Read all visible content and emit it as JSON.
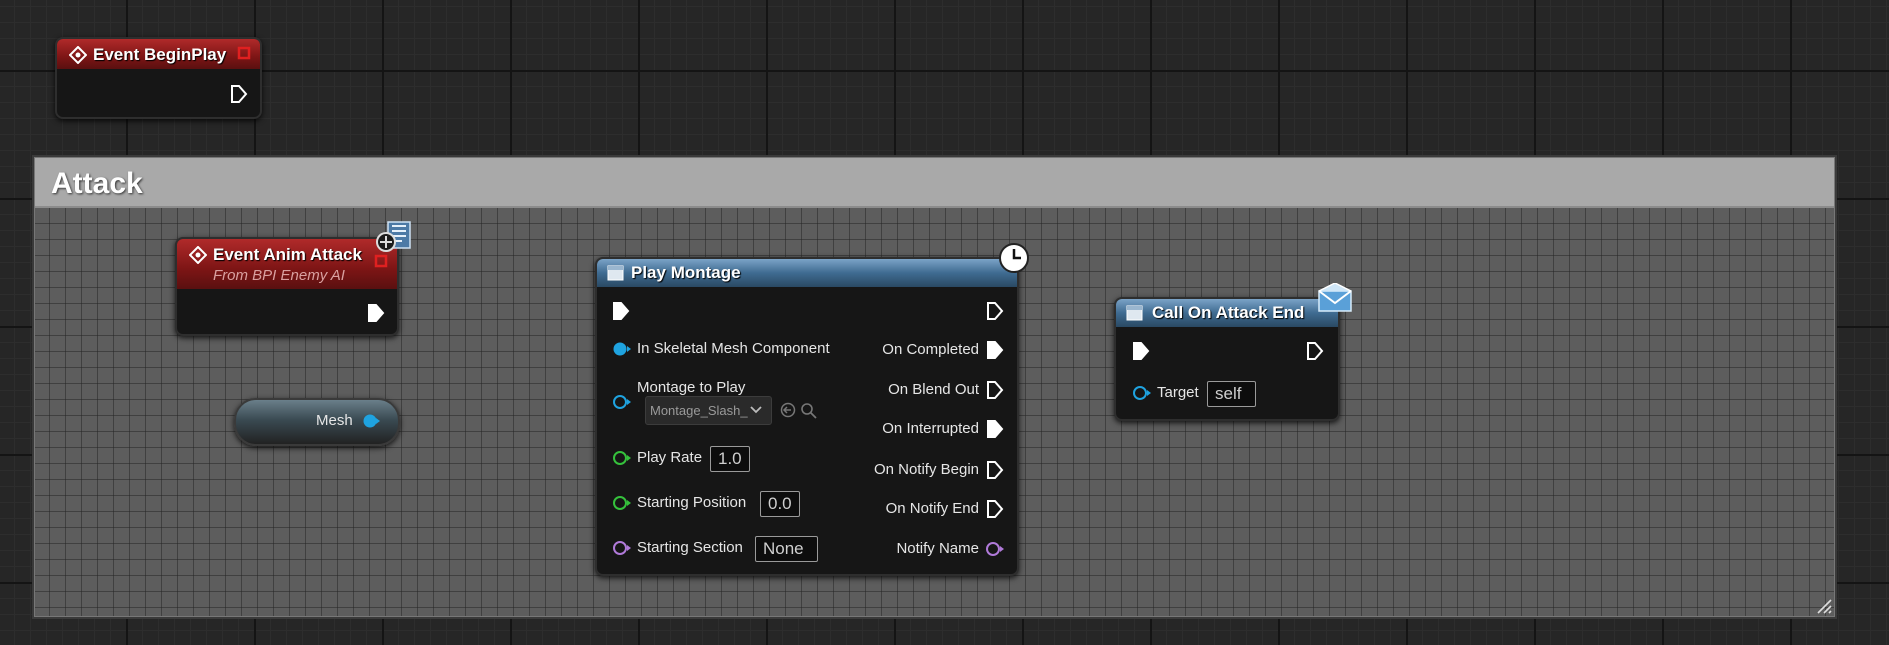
{
  "comment": {
    "title": "Attack"
  },
  "nodes": {
    "begin_play": {
      "title": "Event BeginPlay"
    },
    "anim_attack": {
      "title": "Event Anim Attack",
      "subtitle": "From BPI Enemy AI"
    },
    "mesh_var": {
      "label": "Mesh"
    },
    "play_montage": {
      "title": "Play Montage",
      "inputs": {
        "skeletal_mesh": "In Skeletal Mesh Component",
        "montage_label": "Montage to Play",
        "montage_value": "Montage_Slash_",
        "play_rate_label": "Play Rate",
        "play_rate_value": "1.0",
        "start_pos_label": "Starting Position",
        "start_pos_value": "0.0",
        "start_section_label": "Starting Section",
        "start_section_value": "None"
      },
      "outputs": {
        "on_completed": "On Completed",
        "on_blend_out": "On Blend Out",
        "on_interrupted": "On Interrupted",
        "on_notify_begin": "On Notify Begin",
        "on_notify_end": "On Notify End",
        "notify_name": "Notify Name"
      }
    },
    "attack_end": {
      "title": "Call On Attack End",
      "target_label": "Target",
      "target_value": "self"
    }
  },
  "colors": {
    "event_header": "#9b1f1f",
    "function_header": "#4a7599",
    "object_pin": "#1fa3e0",
    "float_pin": "#35c13c",
    "name_pin": "#b07ad9",
    "exec_pin": "#ffffff",
    "delegate_pin": "#e02020"
  },
  "icons": [
    "event-diamond-icon",
    "delegate-pin-icon",
    "interface-icon",
    "latent-clock-icon",
    "function-icon",
    "message-envelope-icon",
    "asset-browse-icon",
    "asset-search-icon",
    "dropdown-chevron-icon"
  ]
}
